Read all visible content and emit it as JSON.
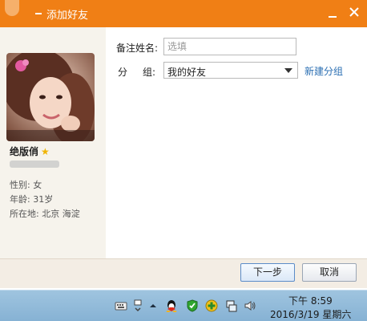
{
  "window": {
    "title": "添加好友"
  },
  "profile": {
    "name": "绝版俏",
    "gender_line": "性别: 女",
    "age_line": "年龄: 31岁",
    "location_line": "所在地: 北京  海淀"
  },
  "form": {
    "remark_label": "备注姓名:",
    "remark_placeholder": "选填",
    "group_label_1": "分",
    "group_label_2": "组:",
    "group_value": "我的好友",
    "new_group_link": "新建分组"
  },
  "buttons": {
    "next": "下一步",
    "cancel": "取消"
  },
  "taskbar": {
    "time": "下午 8:59",
    "date": "2016/3/19 星期六"
  },
  "colors": {
    "titlebar": "#f07f15",
    "link": "#2b6fb3",
    "star": "#f0b400"
  }
}
